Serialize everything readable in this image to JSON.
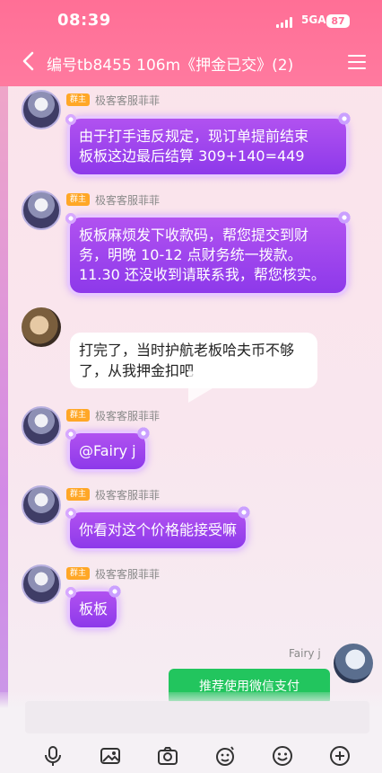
{
  "status": {
    "time": "08:39",
    "network": "5GA",
    "battery": "87"
  },
  "header": {
    "title": "编号tb8455  106m《押金已交》(2)"
  },
  "messages": [
    {
      "role": "群主",
      "sender": "极客客服菲菲",
      "text_lines": [
        "由于打手违反规定，现订单提前结束",
        "板板这边最后结算 309+140=449"
      ]
    },
    {
      "role": "群主",
      "sender": "极客客服菲菲",
      "text_lines": [
        "板板麻烦发下收款码，帮您提交到财",
        "务，明晚 10-12 点财务统一拨款。",
        "11.30 还没收到请联系我，帮您核实。"
      ]
    },
    {
      "text_lines": [
        "打完了，当时护航老板哈夫币不够",
        "了，从我押金扣吧"
      ]
    },
    {
      "role": "群主",
      "sender": "极客客服菲菲",
      "text": "@Fairy  j"
    },
    {
      "role": "群主",
      "sender": "极客客服菲菲",
      "text": "你看对这个价格能接受嘛"
    },
    {
      "role": "群主",
      "sender": "极客客服菲菲",
      "text": "板板"
    },
    {
      "sender": "Fairy  j",
      "button": "推荐使用微信支付"
    }
  ],
  "colors": {
    "header": "#ff6f96",
    "accent_purple": "#9a43ee",
    "pay_green": "#22c55e",
    "role_badge": "#ffa726"
  },
  "icons": [
    "back-icon",
    "menu-icon",
    "voice-icon",
    "image-icon",
    "camera-icon",
    "sticker-icon",
    "emoji-icon",
    "plus-icon"
  ]
}
